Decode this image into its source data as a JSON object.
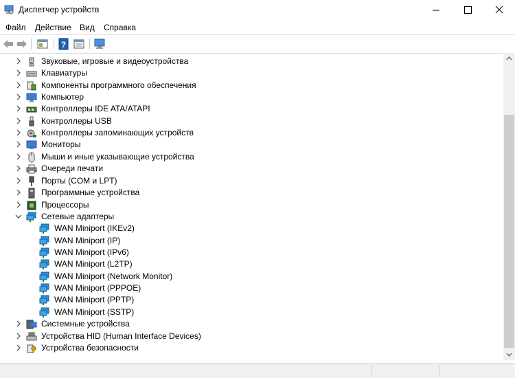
{
  "window": {
    "title": "Диспетчер устройств"
  },
  "menu": {
    "items": [
      "Файл",
      "Действие",
      "Вид",
      "Справка"
    ]
  },
  "toolbar": {
    "icons": [
      "back-arrow-icon",
      "forward-arrow-icon",
      "properties-icon",
      "help-icon",
      "view-icon",
      "scan-hardware-icon"
    ]
  },
  "tree": {
    "nodes": [
      {
        "label": "Звуковые, игровые и видеоустройства",
        "icon": "speaker-icon",
        "expanded": false
      },
      {
        "label": "Клавиатуры",
        "icon": "keyboard-icon",
        "expanded": false
      },
      {
        "label": "Компоненты программного обеспечения",
        "icon": "software-component-icon",
        "expanded": false
      },
      {
        "label": "Компьютер",
        "icon": "computer-icon",
        "expanded": false
      },
      {
        "label": "Контроллеры IDE ATA/ATAPI",
        "icon": "ide-controller-icon",
        "expanded": false
      },
      {
        "label": "Контроллеры USB",
        "icon": "usb-icon",
        "expanded": false
      },
      {
        "label": "Контроллеры запоминающих устройств",
        "icon": "storage-controller-icon",
        "expanded": false
      },
      {
        "label": "Мониторы",
        "icon": "monitor-icon",
        "expanded": false
      },
      {
        "label": "Мыши и иные указывающие устройства",
        "icon": "mouse-icon",
        "expanded": false
      },
      {
        "label": "Очереди печати",
        "icon": "printer-icon",
        "expanded": false
      },
      {
        "label": "Порты (COM и LPT)",
        "icon": "port-icon",
        "expanded": false
      },
      {
        "label": "Программные устройства",
        "icon": "software-device-icon",
        "expanded": false
      },
      {
        "label": "Процессоры",
        "icon": "processor-icon",
        "expanded": false
      },
      {
        "label": "Сетевые адаптеры",
        "icon": "network-adapter-icon",
        "expanded": true,
        "children": [
          "WAN Miniport (IKEv2)",
          "WAN Miniport (IP)",
          "WAN Miniport (IPv6)",
          "WAN Miniport (L2TP)",
          "WAN Miniport (Network Monitor)",
          "WAN Miniport (PPPOE)",
          "WAN Miniport (PPTP)",
          "WAN Miniport (SSTP)"
        ]
      },
      {
        "label": "Системные устройства",
        "icon": "system-device-icon",
        "expanded": false
      },
      {
        "label": "Устройства HID (Human Interface Devices)",
        "icon": "hid-icon",
        "expanded": false
      },
      {
        "label": "Устройства безопасности",
        "icon": "security-device-icon",
        "expanded": false
      }
    ]
  },
  "colors": {
    "network_adapter": "#2a8fd8",
    "monitor": "#3a7fd0",
    "scroll_thumb": "#cdcdcd"
  }
}
